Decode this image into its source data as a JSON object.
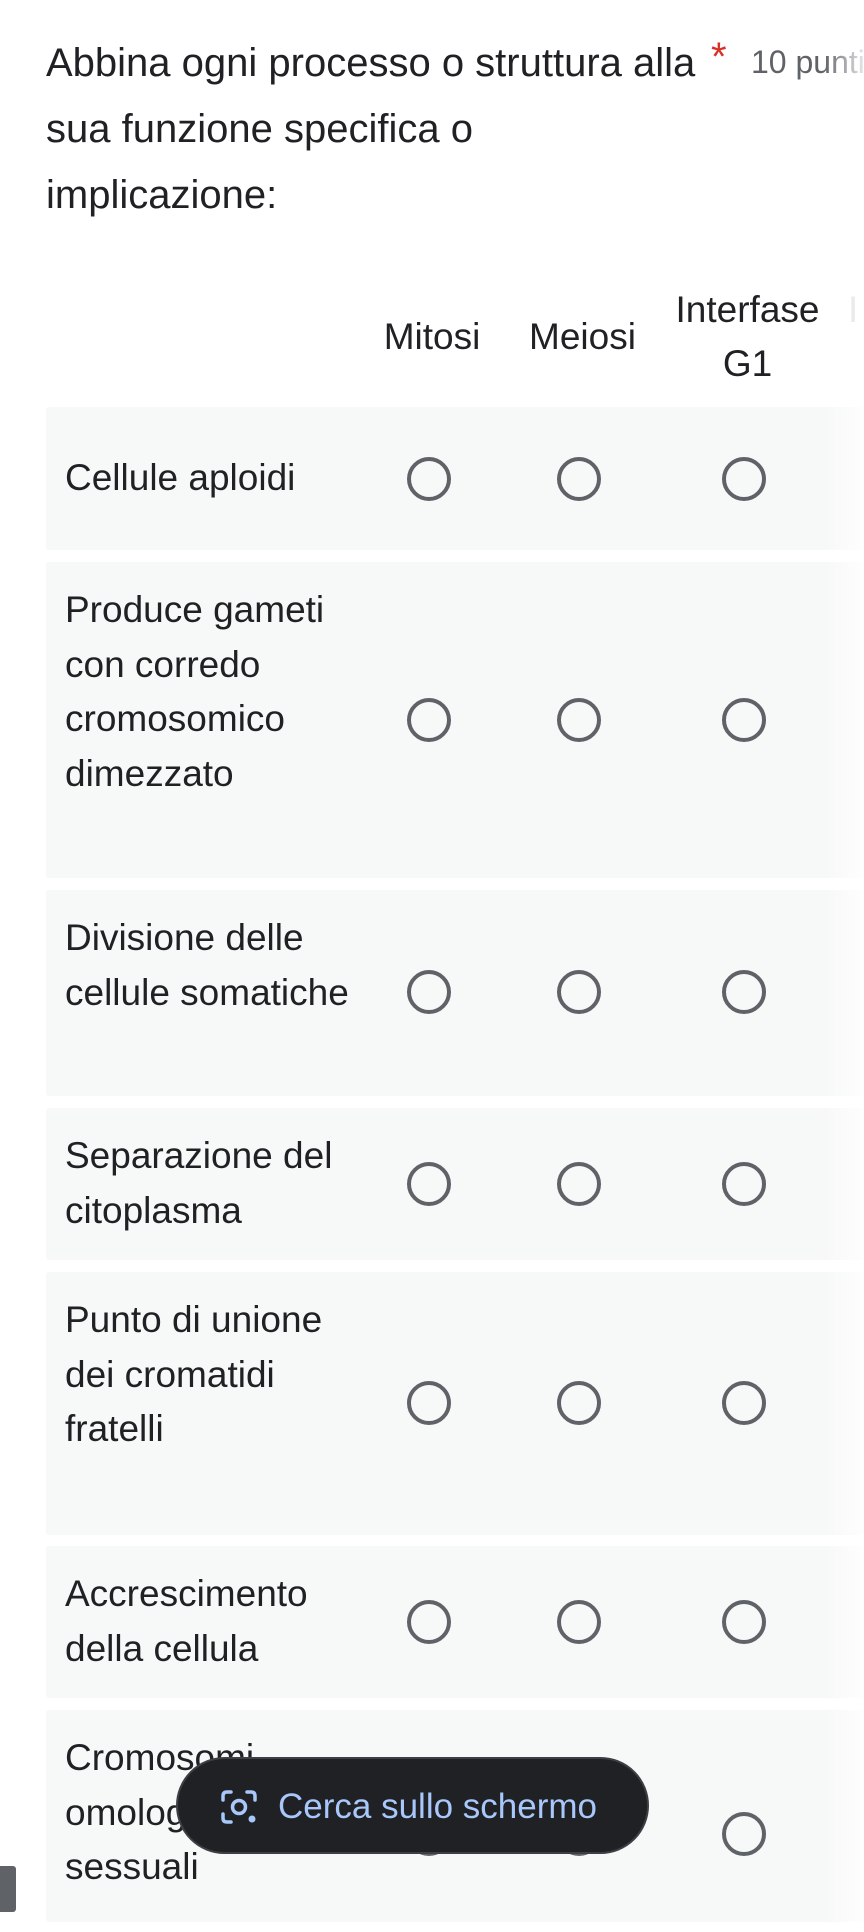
{
  "question": {
    "title": "Abbina ogni processo o struttura alla sua funzione specifica o implicazione:",
    "required_mark": "*",
    "points": "10 punti"
  },
  "grid": {
    "columns": [
      {
        "label": "Mitosi"
      },
      {
        "label": "Meiosi"
      },
      {
        "label": "Interfase G1"
      },
      {
        "label": "I"
      }
    ],
    "rows": [
      {
        "label": "Cellule aploidi"
      },
      {
        "label": "Produce gameti con corredo cromosomico dimezzato"
      },
      {
        "label": "Divisione delle cellule somatiche"
      },
      {
        "label": "Separazione del citoplasma"
      },
      {
        "label": "Punto di unione dei cromatidi fratelli"
      },
      {
        "label": "Accrescimento della cellula"
      },
      {
        "label": "Cromosomi omologhi sessuali"
      }
    ]
  },
  "overlay": {
    "lens_button_label": "Cerca sullo schermo",
    "icon": "screen-search-lens-icon"
  },
  "colors": {
    "required": "#d93025",
    "row_background": "#f7f8f8",
    "radio_border": "#5f6368",
    "pill_background": "#202124",
    "pill_text": "#a8c7fa"
  }
}
